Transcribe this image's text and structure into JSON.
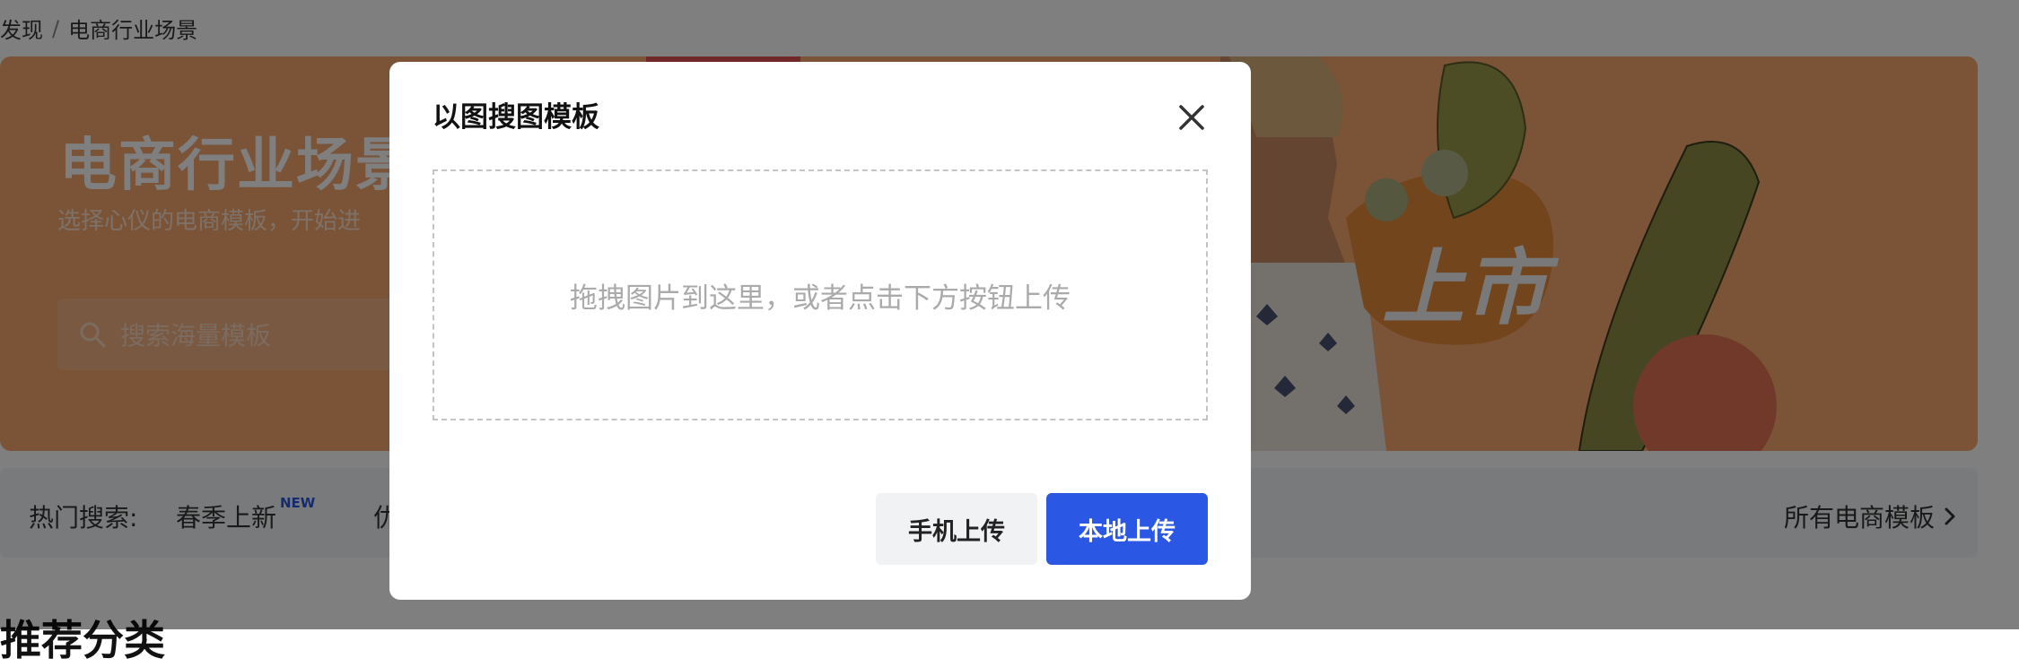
{
  "breadcrumb": {
    "items": [
      "发现",
      "电商行业场景"
    ],
    "separator": "/"
  },
  "banner": {
    "title": "电商行业场景",
    "subtitle": "选择心仪的电商模板，开始进",
    "search_placeholder": "搜索海量模板",
    "art_text": "上市"
  },
  "hot_search": {
    "label": "热门搜索:",
    "items": [
      {
        "text": "春季上新",
        "badge": "NEW"
      },
      {
        "text": "优"
      }
    ],
    "all_link": "所有电商模板"
  },
  "section": {
    "title": "推荐分类"
  },
  "modal": {
    "title": "以图搜图模板",
    "dropzone_text": "拖拽图片到这里，或者点击下方按钮上传",
    "phone_upload": "手机上传",
    "local_upload": "本地上传"
  },
  "colors": {
    "primary": "#2b57e5",
    "banner_bg": "#f6a66e",
    "new_badge": "#2b56e0"
  }
}
